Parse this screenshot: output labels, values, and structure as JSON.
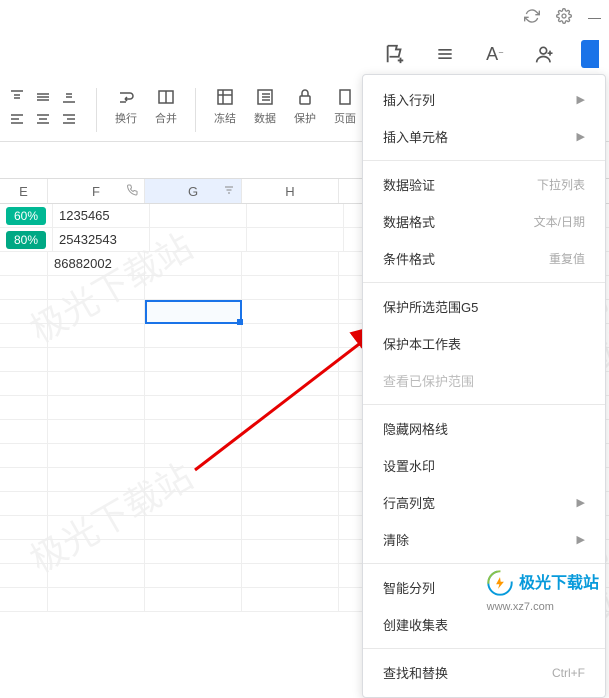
{
  "window_controls": {
    "refresh": "↻",
    "settings": "⚙",
    "minimize": "—"
  },
  "top_toolbar": {
    "flag_add": "⚑+",
    "list": "≡",
    "font": "A",
    "share": "👤"
  },
  "ribbon": {
    "wrap_label": "换行",
    "merge_label": "合并",
    "freeze_label": "冻结",
    "data_label": "数据",
    "protect_label": "保护",
    "page_label": "页面"
  },
  "columns": {
    "e": "E",
    "f": "F",
    "g": "G",
    "h": "H"
  },
  "cells": {
    "e1": "60%",
    "e2": "80%",
    "f1": "1235465",
    "f2": "25432543",
    "f3": "86882002"
  },
  "menu": {
    "insert_rowcol": "插入行列",
    "insert_cell": "插入单元格",
    "data_validate": "数据验证",
    "data_validate_hint": "下拉列表",
    "data_format": "数据格式",
    "data_format_hint": "文本/日期",
    "cond_format": "条件格式",
    "cond_format_hint": "重复值",
    "protect_range": "保护所选范围G5",
    "protect_sheet": "保护本工作表",
    "view_protected": "查看已保护范围",
    "hide_gridlines": "隐藏网格线",
    "set_watermark": "设置水印",
    "row_col_size": "行高列宽",
    "clear": "清除",
    "smart_split": "智能分列",
    "create_form": "创建收集表",
    "find_replace": "查找和替换",
    "find_replace_hint": "Ctrl+F"
  },
  "watermark_text": "极光下载站",
  "logo": {
    "name": "极光下载站",
    "url": "www.xz7.com"
  }
}
